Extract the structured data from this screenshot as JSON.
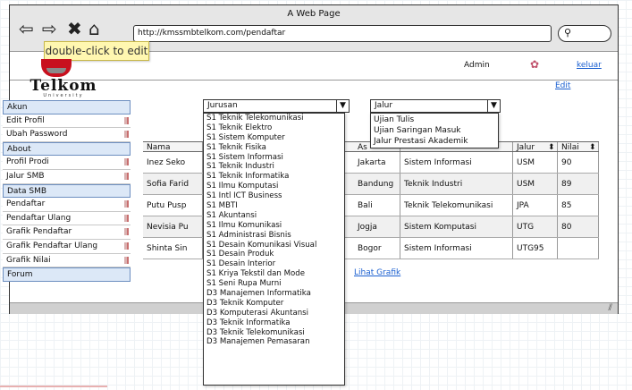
{
  "window": {
    "title": "A Web Page"
  },
  "browser": {
    "url": "http://kmssmbtelkom.com/pendaftar",
    "tooltip": "double-click to edit"
  },
  "header": {
    "admin_label": "Admin",
    "logout_label": "keluar",
    "logo_text": "Telkom",
    "logo_subtext": "University"
  },
  "sidebar": {
    "items": [
      {
        "label": "Akun",
        "section": true
      },
      {
        "label": "Edit Profil",
        "section": false
      },
      {
        "label": "Ubah Password",
        "section": false
      },
      {
        "label": "About",
        "section": true
      },
      {
        "label": "Profil Prodi",
        "section": false
      },
      {
        "label": "Jalur SMB",
        "section": false
      },
      {
        "label": "Data SMB",
        "section": true
      },
      {
        "label": "Pendaftar",
        "section": false
      },
      {
        "label": "Pendaftar Ulang",
        "section": false
      },
      {
        "label": "Grafik Pendaftar",
        "section": false
      },
      {
        "label": "Grafik Pendaftar Ulang",
        "section": false
      },
      {
        "label": "Grafik Nilai",
        "section": false
      },
      {
        "label": "Forum",
        "section": true
      }
    ]
  },
  "main": {
    "edit_label": "Edit",
    "jurusan_select": {
      "value": "Jurusan"
    },
    "jalur_select": {
      "value": "Jalur"
    },
    "lihat_grafik_label": "Lihat Grafik"
  },
  "jurusan_options": [
    "S1 Teknik Telekomunikasi",
    "S1 Teknik Elektro",
    "S1 Sistem Komputer",
    "S1 Teknik Fisika",
    "S1 Sistem Informasi",
    "S1 Teknik Industri",
    "S1 Teknik Informatika",
    "S1 Ilmu Komputasi",
    "S1 Intl ICT Business",
    "S1 MBTI",
    "S1 Akuntansi",
    "S1 Ilmu Komunikasi",
    "S1 Administrasi Bisnis",
    "S1 Desain Komunikasi Visual",
    "S1 Desain Produk",
    "S1 Desain Interior",
    "S1 Kriya Tekstil dan Mode",
    "S1 Seni Rupa Murni",
    "D3 Manajemen Informatika",
    "D3 Teknik Komputer",
    "D3 Komputerasi Akuntansi",
    "D3 Teknik Informatika",
    "D3 Teknik Telekomunikasi",
    "D3 Manajemen Pemasaran"
  ],
  "jalur_options": [
    "Ujian Tulis",
    "Ujian Saringan Masuk",
    "Jalur Prestasi Akademik"
  ],
  "table": {
    "headers": {
      "nama": "Nama",
      "asal": "As",
      "jurusan": "",
      "jalur": "Jalur",
      "nilai": "Nilai"
    },
    "rows": [
      {
        "nama": "Inez Seko",
        "asal": "Jakarta",
        "jurusan": "Sistem Informasi",
        "jalur": "USM",
        "nilai": "90"
      },
      {
        "nama": "Sofia Farid",
        "asal": "Bandung",
        "jurusan": "Teknik Industri",
        "jalur": "USM",
        "nilai": "89"
      },
      {
        "nama": "Putu Pusp",
        "asal": "Bali",
        "jurusan": "Teknik Telekomunikasi",
        "jalur": "JPA",
        "nilai": "85"
      },
      {
        "nama": "Nevisia Pu",
        "asal": "Jogja",
        "jurusan": "Sistem Komputasi",
        "jalur": "UTG",
        "nilai": "80"
      },
      {
        "nama": "Shinta Sin",
        "asal": "Bogor",
        "jurusan": "Sistem Informasi",
        "jalur": "UTG95",
        "nilai": ""
      }
    ]
  },
  "colors": {
    "section_bg": "#dce8f7",
    "link": "#1a5fd0",
    "tooltip_bg": "#fff7b0",
    "logo_red": "#c8101e",
    "row_alt_bg": "#f0f0f0"
  }
}
